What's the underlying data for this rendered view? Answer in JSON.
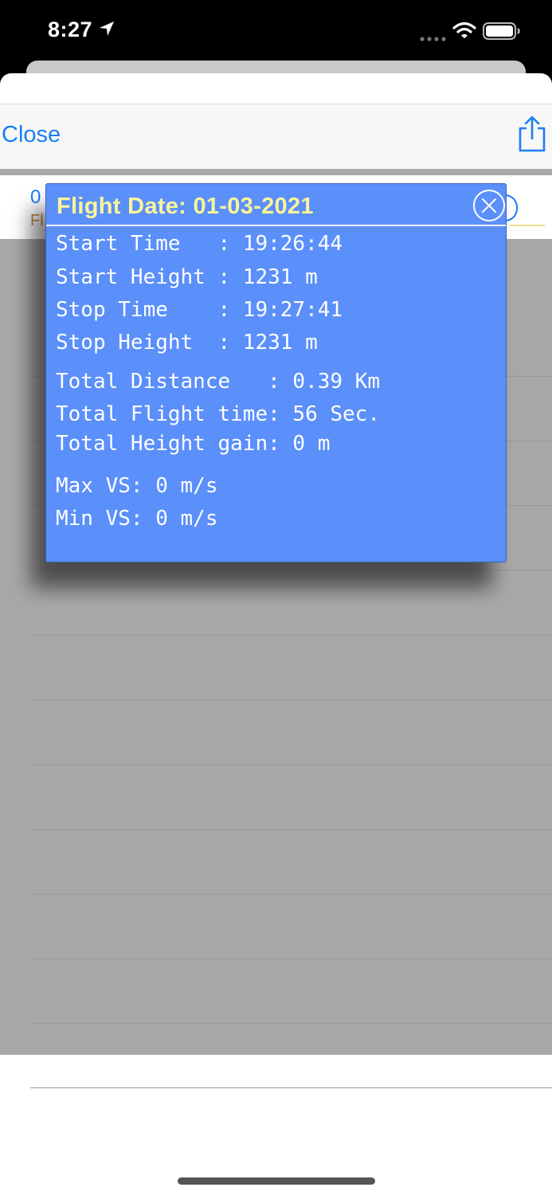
{
  "status_bar": {
    "time": "8:27",
    "icons": [
      "location-arrow-icon",
      "cellular-signal-icon",
      "wifi-icon",
      "battery-icon"
    ]
  },
  "nav": {
    "close_label": "Close",
    "share_icon": "share-icon"
  },
  "list": {
    "first_row_date_fragment": "0",
    "first_row_sub_fragment": "Fl"
  },
  "popup": {
    "title": "Flight Date: 01-03-2021",
    "close_icon": "close-circle-icon",
    "lines": {
      "start_time": "Start Time   : 19:26:44",
      "start_height": "Start Height : 1231 m",
      "stop_time": "Stop Time    : 19:27:41",
      "stop_height": "Stop Height  : 1231 m",
      "total_distance": "Total Distance   : 0.39 Km",
      "total_flight_time": "Total Flight time: 56 Sec.",
      "total_height_gain": "Total Height gain: 0 m",
      "max_vs": "Max VS: 0 m/s",
      "min_vs": "Min VS: 0 m/s"
    }
  },
  "colors": {
    "accent": "#1a7ff2",
    "popup_background": "#5b8ffa",
    "popup_title": "#f9f59a",
    "row_subtitle": "#c98448"
  }
}
